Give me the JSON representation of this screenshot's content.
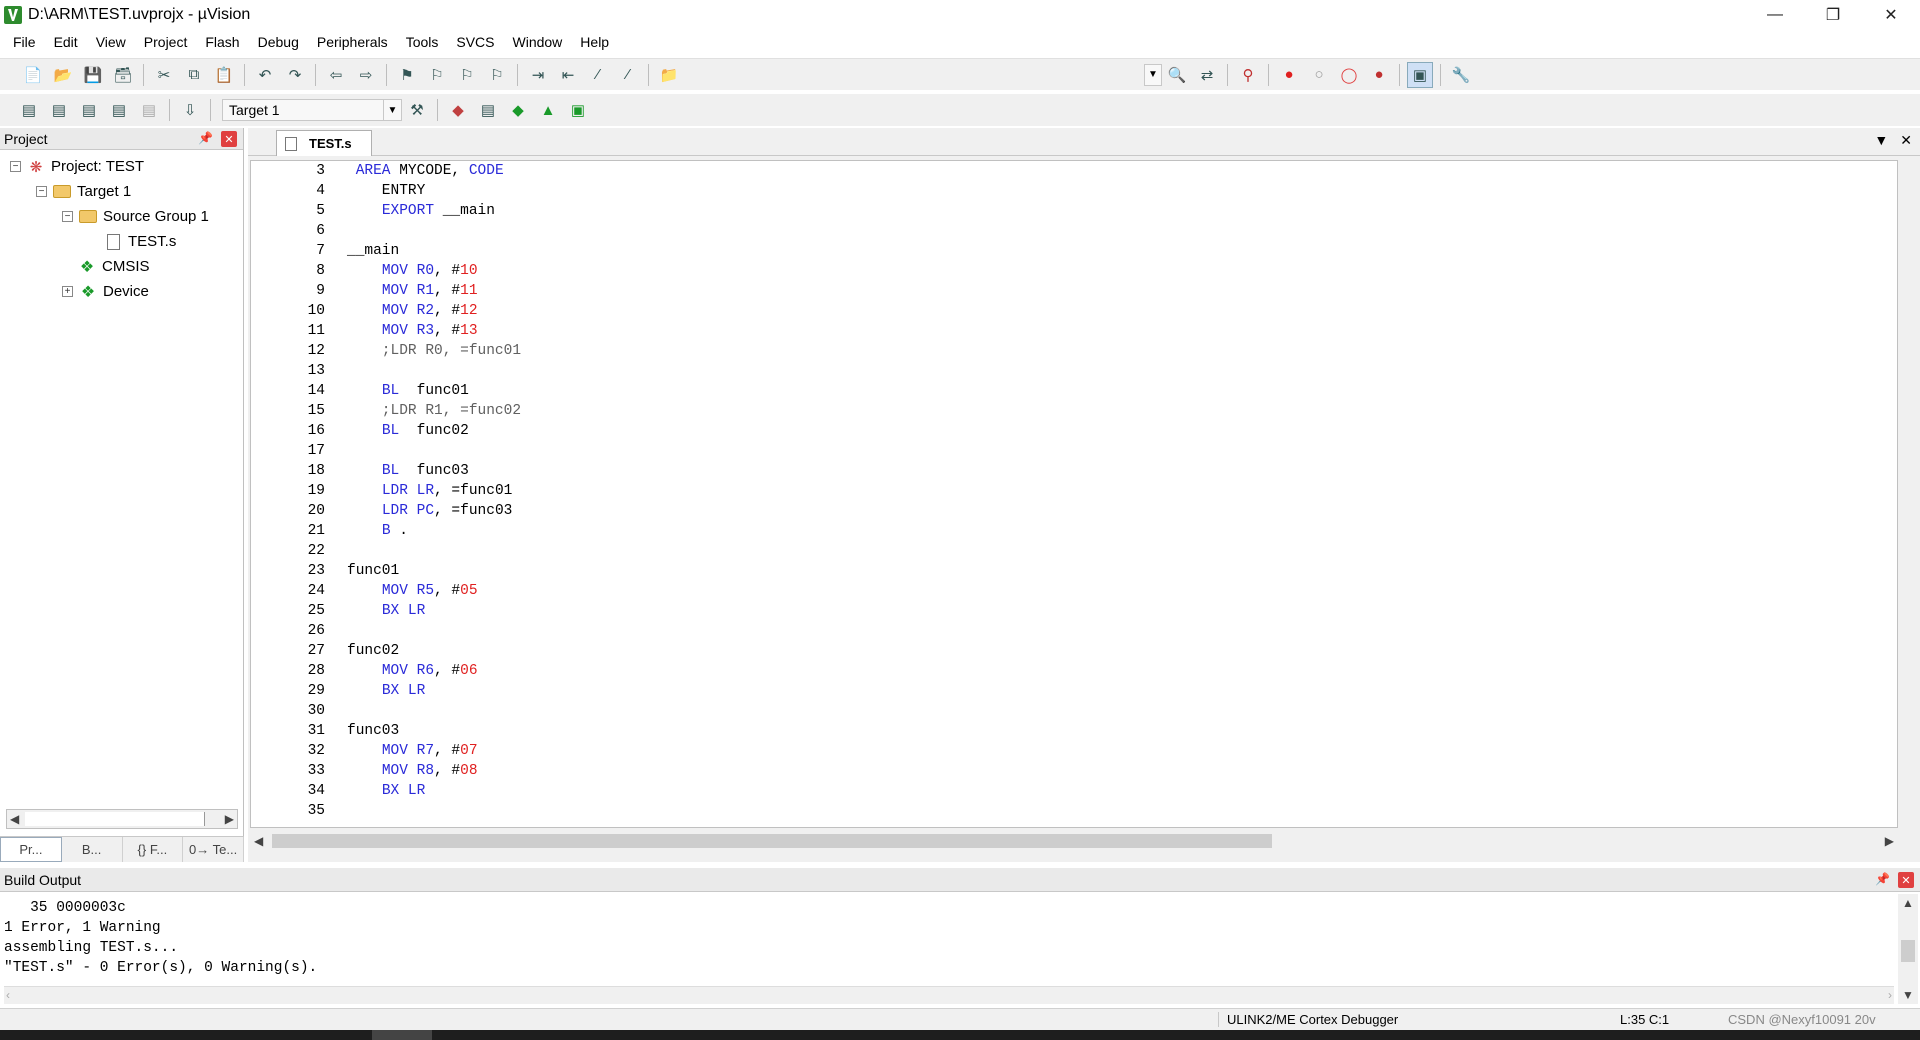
{
  "window": {
    "title": "D:\\ARM\\TEST.uvprojx - µVision"
  },
  "menu": [
    "File",
    "Edit",
    "View",
    "Project",
    "Flash",
    "Debug",
    "Peripherals",
    "Tools",
    "SVCS",
    "Window",
    "Help"
  ],
  "toolbar2": {
    "target": "Target 1"
  },
  "project_panel": {
    "title": "Project",
    "tree": {
      "project": "Project: TEST",
      "target": "Target 1",
      "group": "Source Group 1",
      "file": "TEST.s",
      "cmsis": "CMSIS",
      "device": "Device"
    },
    "tabs": [
      "Pr...",
      "B...",
      "{} F...",
      "0→ Te..."
    ]
  },
  "editor": {
    "tab": "TEST.s",
    "lines": [
      {
        "n": "3",
        "parts": [
          [
            "plain",
            " "
          ],
          [
            "kw",
            "AREA"
          ],
          [
            "plain",
            " MYCODE, "
          ],
          [
            "kw",
            "CODE"
          ]
        ]
      },
      {
        "n": "4",
        "parts": [
          [
            "plain",
            "    ENTRY"
          ]
        ]
      },
      {
        "n": "5",
        "parts": [
          [
            "plain",
            "    "
          ],
          [
            "kw",
            "EXPORT"
          ],
          [
            "plain",
            " __main"
          ]
        ]
      },
      {
        "n": "6",
        "parts": []
      },
      {
        "n": "7",
        "parts": [
          [
            "plain",
            "__main"
          ]
        ]
      },
      {
        "n": "8",
        "parts": [
          [
            "plain",
            "    "
          ],
          [
            "kw",
            "MOV R0"
          ],
          [
            "plain",
            ", #"
          ],
          [
            "num",
            "10"
          ]
        ]
      },
      {
        "n": "9",
        "parts": [
          [
            "plain",
            "    "
          ],
          [
            "kw",
            "MOV R1"
          ],
          [
            "plain",
            ", #"
          ],
          [
            "num",
            "11"
          ]
        ]
      },
      {
        "n": "10",
        "parts": [
          [
            "plain",
            "    "
          ],
          [
            "kw",
            "MOV R2"
          ],
          [
            "plain",
            ", #"
          ],
          [
            "num",
            "12"
          ]
        ]
      },
      {
        "n": "11",
        "parts": [
          [
            "plain",
            "    "
          ],
          [
            "kw",
            "MOV R3"
          ],
          [
            "plain",
            ", #"
          ],
          [
            "num",
            "13"
          ]
        ]
      },
      {
        "n": "12",
        "parts": [
          [
            "cmt",
            "    ;LDR R0, =func01"
          ]
        ]
      },
      {
        "n": "13",
        "parts": []
      },
      {
        "n": "14",
        "parts": [
          [
            "plain",
            "    "
          ],
          [
            "kw",
            "BL"
          ],
          [
            "plain",
            "  func01"
          ]
        ]
      },
      {
        "n": "15",
        "parts": [
          [
            "cmt",
            "    ;LDR R1, =func02"
          ]
        ]
      },
      {
        "n": "16",
        "parts": [
          [
            "plain",
            "    "
          ],
          [
            "kw",
            "BL"
          ],
          [
            "plain",
            "  func02"
          ]
        ]
      },
      {
        "n": "17",
        "parts": []
      },
      {
        "n": "18",
        "parts": [
          [
            "plain",
            "    "
          ],
          [
            "kw",
            "BL"
          ],
          [
            "plain",
            "  func03"
          ]
        ]
      },
      {
        "n": "19",
        "parts": [
          [
            "plain",
            "    "
          ],
          [
            "kw",
            "LDR LR"
          ],
          [
            "plain",
            ", =func01"
          ]
        ]
      },
      {
        "n": "20",
        "parts": [
          [
            "plain",
            "    "
          ],
          [
            "kw",
            "LDR PC"
          ],
          [
            "plain",
            ", =func03"
          ]
        ]
      },
      {
        "n": "21",
        "parts": [
          [
            "plain",
            "    "
          ],
          [
            "kw",
            "B"
          ],
          [
            "plain",
            " ."
          ]
        ]
      },
      {
        "n": "22",
        "parts": []
      },
      {
        "n": "23",
        "parts": [
          [
            "plain",
            "func01"
          ]
        ]
      },
      {
        "n": "24",
        "parts": [
          [
            "plain",
            "    "
          ],
          [
            "kw",
            "MOV R5"
          ],
          [
            "plain",
            ", #"
          ],
          [
            "num",
            "05"
          ]
        ]
      },
      {
        "n": "25",
        "parts": [
          [
            "plain",
            "    "
          ],
          [
            "kw",
            "BX LR"
          ]
        ]
      },
      {
        "n": "26",
        "parts": []
      },
      {
        "n": "27",
        "parts": [
          [
            "plain",
            "func02"
          ]
        ]
      },
      {
        "n": "28",
        "parts": [
          [
            "plain",
            "    "
          ],
          [
            "kw",
            "MOV R6"
          ],
          [
            "plain",
            ", #"
          ],
          [
            "num",
            "06"
          ]
        ]
      },
      {
        "n": "29",
        "parts": [
          [
            "plain",
            "    "
          ],
          [
            "kw",
            "BX LR"
          ]
        ]
      },
      {
        "n": "30",
        "parts": []
      },
      {
        "n": "31",
        "parts": [
          [
            "plain",
            "func03"
          ]
        ]
      },
      {
        "n": "32",
        "parts": [
          [
            "plain",
            "    "
          ],
          [
            "kw",
            "MOV R7"
          ],
          [
            "plain",
            ", #"
          ],
          [
            "num",
            "07"
          ]
        ]
      },
      {
        "n": "33",
        "parts": [
          [
            "plain",
            "    "
          ],
          [
            "kw",
            "MOV R8"
          ],
          [
            "plain",
            ", #"
          ],
          [
            "num",
            "08"
          ]
        ]
      },
      {
        "n": "34",
        "parts": [
          [
            "plain",
            "    "
          ],
          [
            "kw",
            "BX LR"
          ]
        ]
      },
      {
        "n": "35",
        "parts": []
      }
    ]
  },
  "build_output": {
    "title": "Build Output",
    "lines": [
      "   35 0000003c",
      "1 Error, 1 Warning",
      "assembling TEST.s...",
      "\"TEST.s\" - 0 Error(s), 0 Warning(s)."
    ]
  },
  "status": {
    "debugger": "ULINK2/ME Cortex Debugger",
    "position": "L:35 C:1",
    "watermark": "CSDN @Nexyf10091 20v"
  },
  "colors": {
    "keyword": "#2a2ad8",
    "number": "#e02020",
    "comment": "#606060",
    "diamond": "#1a9a2a"
  }
}
